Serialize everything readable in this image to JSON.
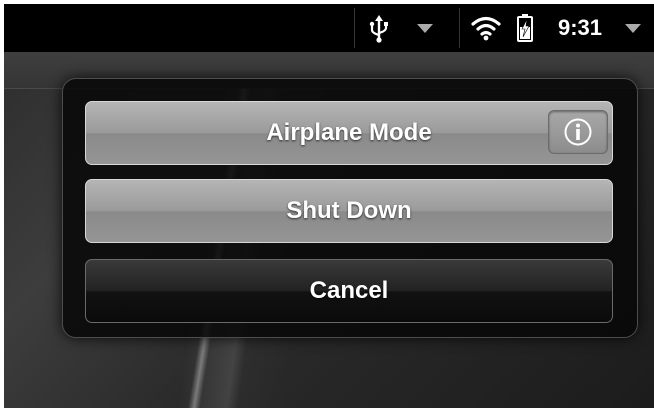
{
  "status_bar": {
    "time": "9:31",
    "icons": [
      "usb-icon",
      "menu-arrow-icon",
      "wifi-icon",
      "battery-charging-icon",
      "menu-arrow-icon"
    ]
  },
  "dialog": {
    "airplane_mode_label": "Airplane Mode",
    "info_icon": "info-icon",
    "shut_down_label": "Shut Down",
    "cancel_label": "Cancel"
  },
  "colors": {
    "status_bar_bg": "#000000",
    "dialog_bg": "#080808",
    "light_button": "#9a9a9a",
    "dark_button": "#1a1a1a",
    "text": "#ffffff"
  }
}
